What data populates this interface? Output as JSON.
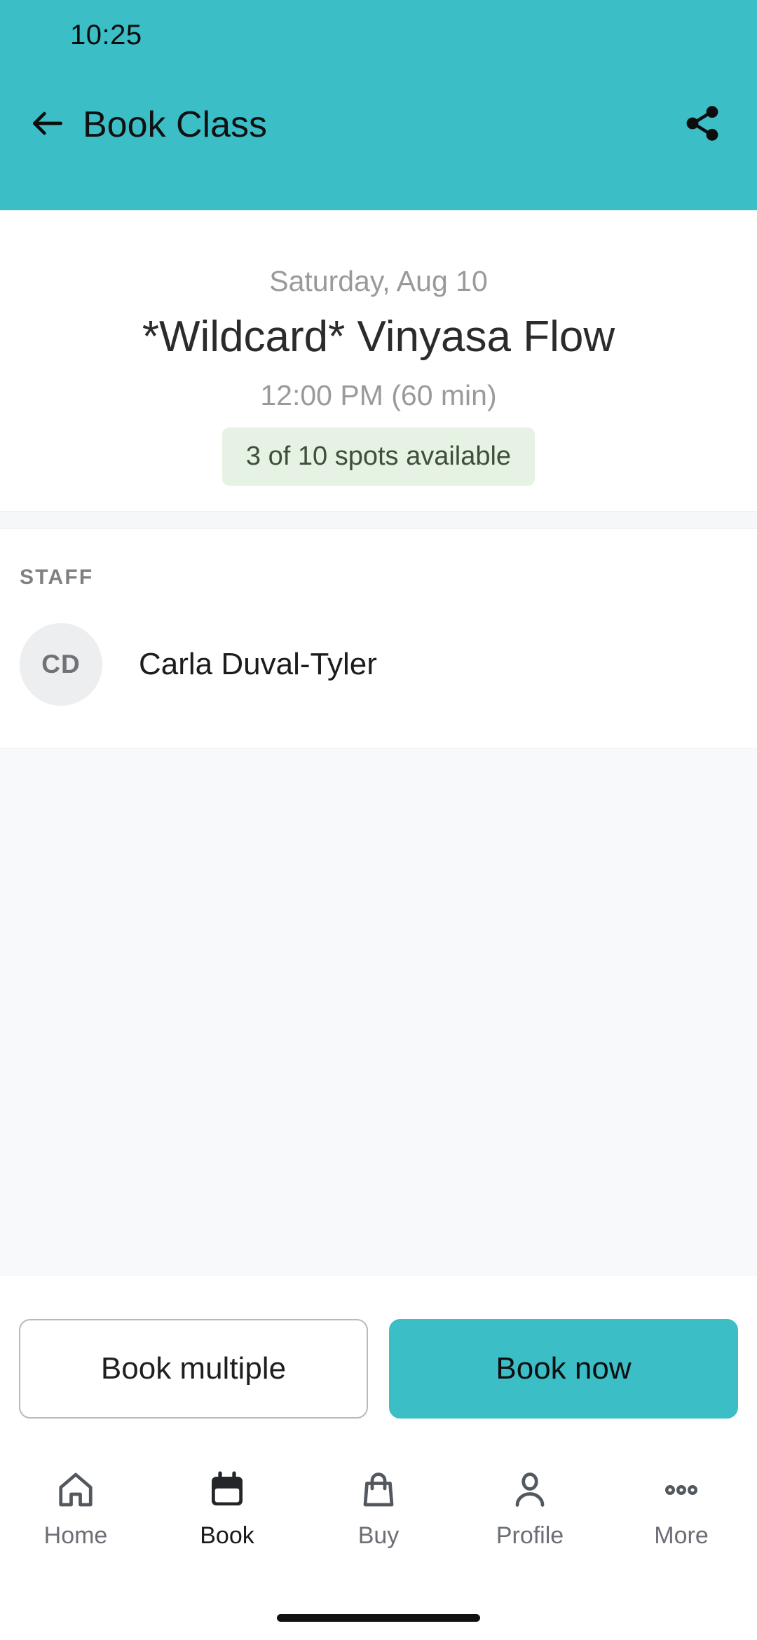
{
  "statusbar": {
    "time": "10:25"
  },
  "header": {
    "title": "Book Class",
    "back_icon": "arrow-left-icon",
    "share_icon": "share-icon",
    "background_color": "#3bbec6"
  },
  "class": {
    "date": "Saturday, Aug 10",
    "title": "*Wildcard* Vinyasa Flow",
    "time": "12:00 PM (60 min)",
    "spots": "3 of 10 spots available",
    "spots_background_color": "#e6f2e4",
    "spots_text_color": "#3f4f3c"
  },
  "staff": {
    "section_label": "STAFF",
    "members": [
      {
        "initials": "CD",
        "name": "Carla Duval-Tyler"
      }
    ]
  },
  "actions": {
    "secondary_label": "Book multiple",
    "primary_label": "Book now",
    "primary_color": "#3bbec6"
  },
  "bottom_nav": {
    "items": [
      {
        "label": "Home",
        "icon": "home-icon",
        "active": false
      },
      {
        "label": "Book",
        "icon": "calendar-icon",
        "active": true
      },
      {
        "label": "Buy",
        "icon": "shopping-bag-icon",
        "active": false
      },
      {
        "label": "Profile",
        "icon": "person-icon",
        "active": false
      },
      {
        "label": "More",
        "icon": "ellipsis-icon",
        "active": false
      }
    ]
  }
}
